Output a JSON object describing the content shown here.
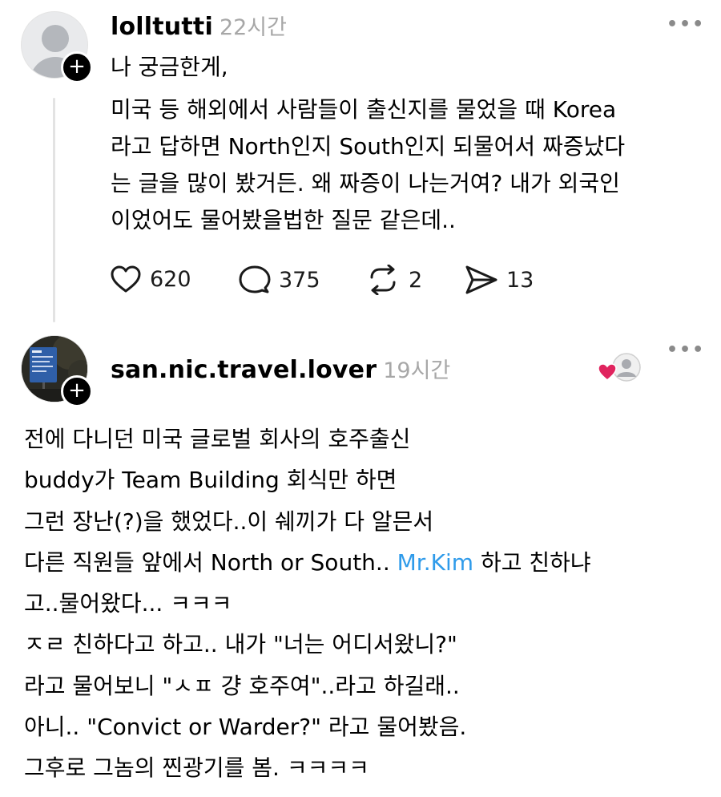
{
  "post": {
    "username": "lolltutti",
    "time": "22시간",
    "lines": [
      "나 궁금한게,",
      "미국 등 해외에서 사람들이 출신지를 물었을 때 Korea",
      "라고 답하면 North인지 South인지 되물어서 짜증났다",
      "는 글을 많이 봤거든. 왜 짜증이 나는거여? 내가 외국인",
      "이었어도 물어봤을법한 질문 같은데.."
    ],
    "actions": {
      "likes": "620",
      "replies": "375",
      "reposts": "2",
      "shares": "13"
    }
  },
  "reply": {
    "username": "san.nic.travel.lover",
    "time": "19시간",
    "lines": [
      "전에 다니던 미국 글로벌 회사의 호주출신",
      "buddy가 Team Building 회식만 하면",
      "그런 장난(?)을 했었다..이 쉐끼가 다 알믄서",
      "다른 직원들 앞에서 North or South..",
      "고..물어왔다... ㅋㅋㅋ",
      "ㅈㄹ 친하다고 하고.. 내가 \"너는 어디서왔니?\"",
      "라고 물어보니 \"ㅅㅍ 걍 호주여\"..라고 하길래..",
      "아니.. \"Convict or Warder?\" 라고 물어봤음.",
      "그후로 그놈의 찐광기를 봄. ㅋㅋㅋㅋ"
    ],
    "mention": "Mr.Kim",
    "line4_tail": "하고 친하냐"
  },
  "more_glyph": "•••",
  "plus_glyph": "+",
  "colors": {
    "mention": "#2f9bea",
    "time": "#a7a7a7",
    "heart": "#e0245e"
  }
}
